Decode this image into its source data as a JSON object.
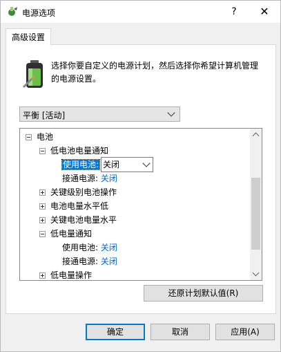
{
  "window": {
    "title": "电源选项",
    "help_glyph": "?",
    "close_glyph": "✕"
  },
  "tab": {
    "label": "高级设置"
  },
  "description": "选择你要自定义的电源计划，然后选择你希望计算机管理的电源设置。",
  "plan_select": {
    "value": "平衡 [活动]"
  },
  "tree": {
    "battery": "电池",
    "low_notify": "低电池电量通知",
    "on_battery_label": "使用电池:",
    "on_battery_value": "关闭",
    "plugged_in_label": "接通电源:",
    "plugged_in_value": "关闭",
    "critical_action": "关键级别电池操作",
    "low_level": "电池电量水平低",
    "critical_level": "关键电池电量水平",
    "low_notify2": "低电量通知",
    "on_battery_label2": "使用电池:",
    "on_battery_value2": "关闭",
    "plugged_in_label2": "接通电源:",
    "plugged_in_value2": "关闭",
    "low_action": "低电量操作"
  },
  "buttons": {
    "restore": "还原计划默认值(R)",
    "ok": "确定",
    "cancel": "取消",
    "apply": "应用(A)"
  },
  "colors": {
    "link": "#0066cc",
    "selection": "#0078d7"
  }
}
